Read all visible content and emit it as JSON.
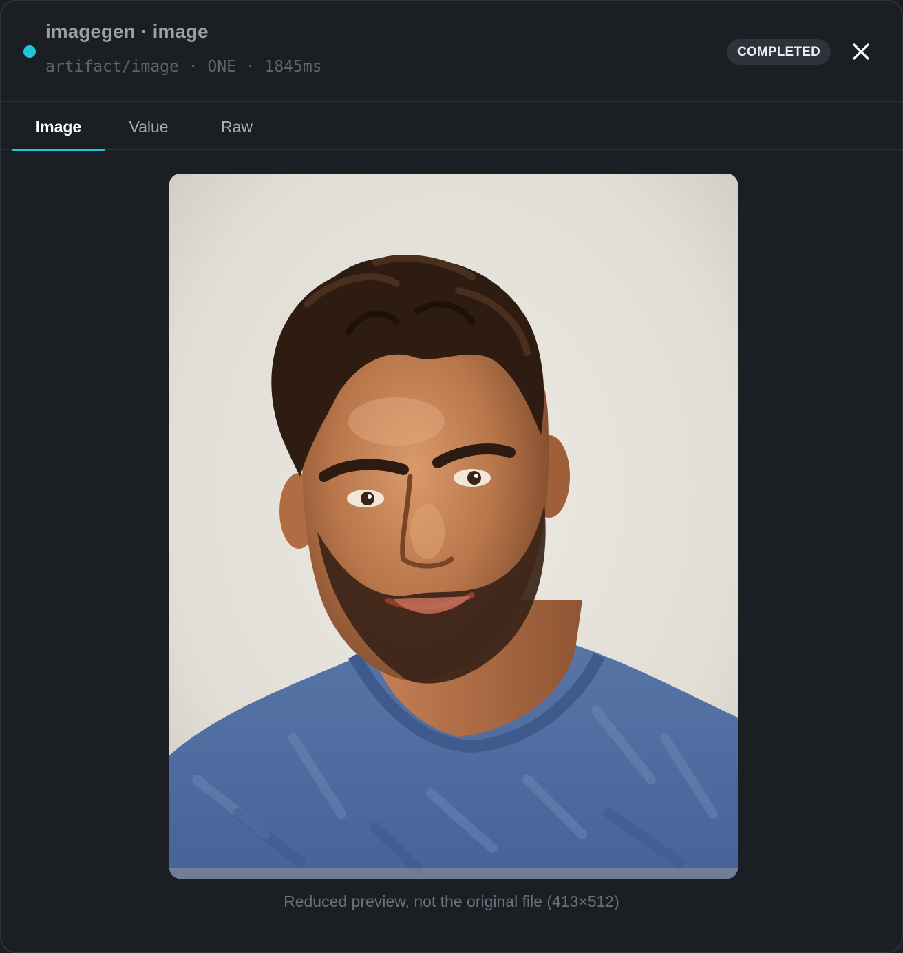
{
  "header": {
    "title": "imagegen · image",
    "subtitle": "artifact/image · ONE · 1845ms",
    "status": "COMPLETED",
    "accent_color": "#20c5d9",
    "close_icon": "close-icon"
  },
  "tabs": [
    {
      "label": "Image",
      "active": true
    },
    {
      "label": "Value",
      "active": false
    },
    {
      "label": "Raw",
      "active": false
    }
  ],
  "preview": {
    "caption": "Reduced preview, not the original file (413×512)"
  }
}
